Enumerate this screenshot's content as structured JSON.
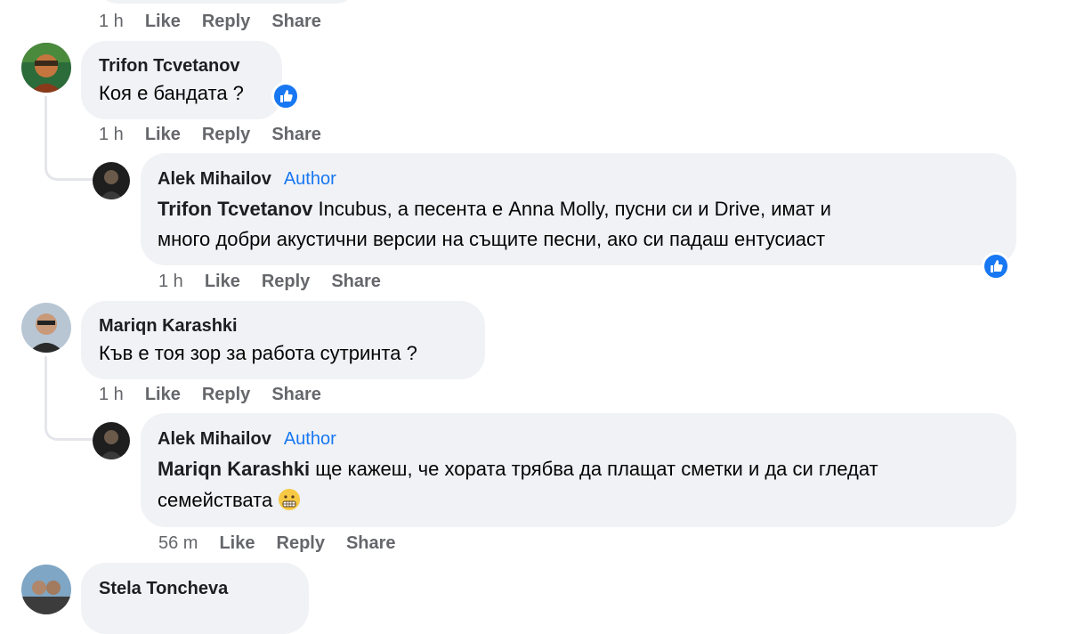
{
  "top_actions": {
    "time": "1 h",
    "like": "Like",
    "reply": "Reply",
    "share": "Share"
  },
  "comments": [
    {
      "author": "Trifon Tcvetanov",
      "text": "Коя е бандата ?",
      "time": "1 h",
      "like": "Like",
      "reply": "Reply",
      "share": "Share",
      "reaction": "like-icon"
    },
    {
      "author": "Alek Mihailov",
      "badge": "Author",
      "mention": "Trifon Tcvetanov",
      "line1": "Incubus, а песента е Anna Molly, пусни си и Drive, имат и",
      "line2": "много добри акустични версии на същите песни, ако си падаш ентусиаст",
      "time": "1 h",
      "like": "Like",
      "reply": "Reply",
      "share": "Share",
      "reaction": "like-icon"
    },
    {
      "author": "Mariqn Karashki",
      "text": "Къв е тоя зор за работа сутринта ?",
      "time": "1 h",
      "like": "Like",
      "reply": "Reply",
      "share": "Share"
    },
    {
      "author": "Alek Mihailov",
      "badge": "Author",
      "mention": "Mariqn Karashki",
      "line1": "ще кажеш, че хората трябва да плащат сметки и да си гледат",
      "line2": "семействата",
      "emoji": "grimacing-face-emoji",
      "time": "56 m",
      "like": "Like",
      "reply": "Reply",
      "share": "Share"
    },
    {
      "author": "Stela Toncheva"
    }
  ],
  "colors": {
    "bubble": "#f0f2f5",
    "link": "#1877f2",
    "meta": "#65676b"
  }
}
